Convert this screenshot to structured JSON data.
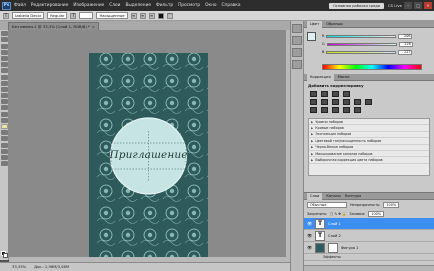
{
  "titlebar": {
    "logo": "Ps",
    "menu": [
      "Файл",
      "Редактирование",
      "Изображение",
      "Слои",
      "Выделение",
      "Фильтр",
      "Просмотр",
      "Окно",
      "Справка"
    ],
    "workspace_button": "Основная рабочая среда",
    "cs_live": "CS Live"
  },
  "optbar": {
    "font_family": "Izabella Decor",
    "font_style": "Regular",
    "font_size": "",
    "antialias": "Насыщенное"
  },
  "doc_tab": {
    "title": "Без имени-1 @ 33,3% (Слой 1, RGB/8) *"
  },
  "canvas": {
    "label": "Приглашение",
    "bg_color": "#2e5a5c",
    "pattern_color": "#9fd0cc",
    "circle_color": "#c6e4e3"
  },
  "statusbar": {
    "zoom": "33,33%",
    "doc_info": "Док.: 2,98M/3,08M"
  },
  "color_panel": {
    "tabs": [
      "Цвет",
      "Образцы"
    ],
    "r_label": "R",
    "g_label": "G",
    "b_label": "B",
    "r_value": "206",
    "g_value": "228",
    "b_value": "227"
  },
  "adjustments": {
    "tabs": [
      "Коррекция",
      "Маски"
    ],
    "title": "Добавить корректировку",
    "presets": [
      "Уровни наборов",
      "Кривые наборов",
      "Экспозиция наборов",
      "Цветовой тон/насыщенность наборов",
      "Черно-белые наборов",
      "Микширование каналов наборов",
      "Выборочная коррекция цвета наборов"
    ]
  },
  "layers": {
    "tabs": [
      "Слои",
      "Каналы",
      "Контуры"
    ],
    "blend_mode": "Обычные",
    "opacity_label": "Непрозрачность:",
    "opacity_value": "100%",
    "fill_label": "Заливка:",
    "fill_value": "100%",
    "lock_label": "Закрепить:",
    "rows": [
      {
        "thumb": "T",
        "name": "Слой 1"
      },
      {
        "thumb": "T",
        "name": "Слой 2"
      },
      {
        "thumb": "",
        "name": "Фигура 1"
      }
    ],
    "footer_text": "Эффекты"
  },
  "colors": {
    "accent": "#3c8ef0",
    "doc_bg": "#2e5a5c"
  }
}
